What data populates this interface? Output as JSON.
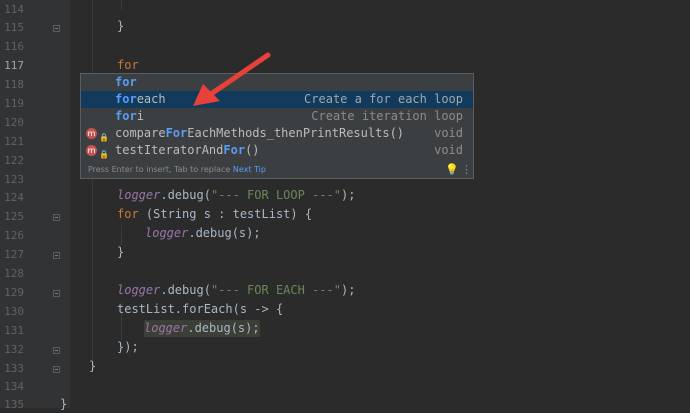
{
  "line_numbers": [
    "114",
    "115",
    "116",
    "117",
    "118",
    "119",
    "120",
    "121",
    "122",
    "123",
    "124",
    "125",
    "126",
    "127",
    "128",
    "129",
    "130",
    "131",
    "132",
    "133",
    "134",
    "135"
  ],
  "typed_text": "for",
  "code": {
    "l115": "}",
    "l124_fn": "logger",
    "l124_call": ".debug(",
    "l124_str": "\"--- FOR LOOP ---\"",
    "l124_end": ");",
    "l125_kw": "for",
    "l125_rest": " (String s : testList) {",
    "l126_fn": "logger",
    "l126_rest": ".debug(s);",
    "l127": "}",
    "l129_fn": "logger",
    "l129_call": ".debug(",
    "l129_str": "\"--- FOR EACH ---\"",
    "l129_end": ");",
    "l130": "testList.forEach(s -> {",
    "l131_fn": "logger",
    "l131_rest": ".debug(s);",
    "l132": "});",
    "l133": "}",
    "l135": "}"
  },
  "completion": {
    "items": [
      {
        "match": "for",
        "rest": "",
        "type": ""
      },
      {
        "match": "for",
        "rest": "each",
        "type": "Create a for each loop"
      },
      {
        "match": "for",
        "rest": "i",
        "type": "Create iteration loop"
      },
      {
        "pre": "compare",
        "match": "For",
        "rest": "EachMethods_thenPrintResults",
        "args": "()",
        "type": "void",
        "badge": "m"
      },
      {
        "pre": "testIteratorAnd",
        "match": "For",
        "rest": "",
        "args": "()",
        "type": "void",
        "badge": "m"
      }
    ],
    "footer": "Press Enter to insert, Tab to replace",
    "next_tip": "Next Tip"
  },
  "colors": {
    "keyword": "#cc7832",
    "field": "#9876aa",
    "string": "#6a8759",
    "selection": "#113a5c",
    "arrow": "#e8403a"
  }
}
